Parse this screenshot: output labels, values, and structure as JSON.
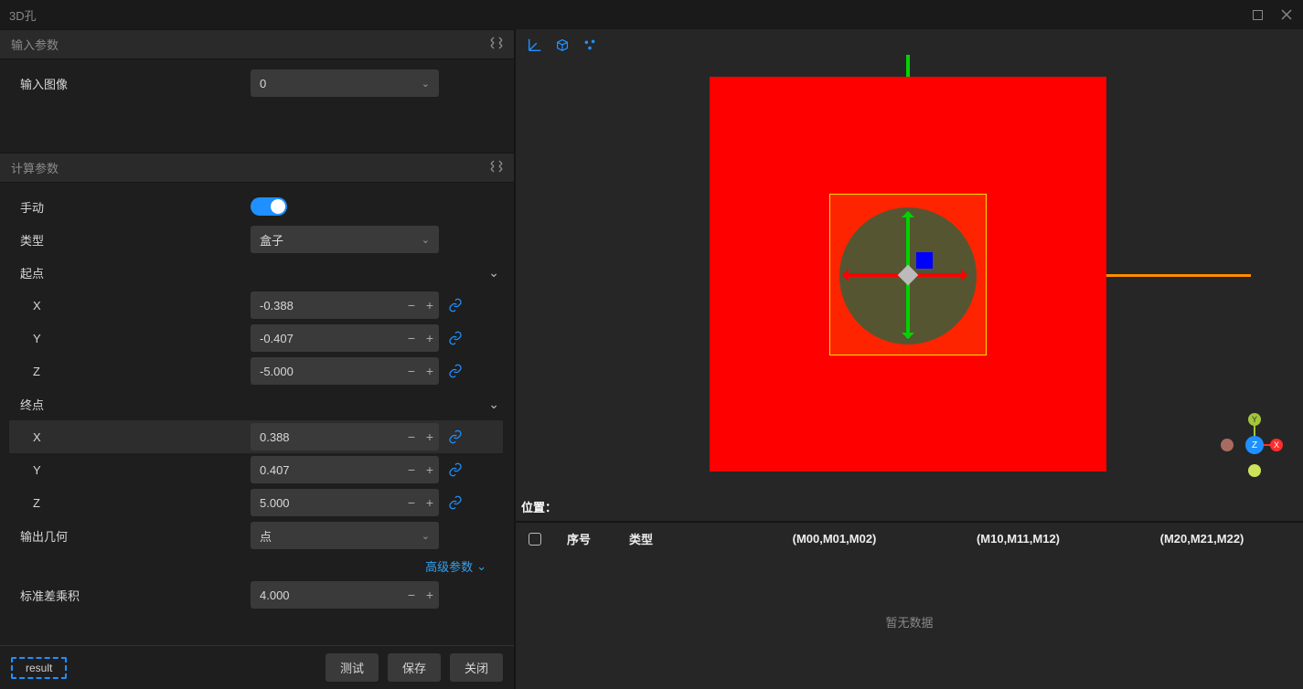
{
  "window": {
    "title": "3D孔"
  },
  "sections": {
    "input": "输入参数",
    "calc": "计算参数"
  },
  "input_params": {
    "image_label": "输入图像",
    "image_value": "0"
  },
  "calc_params": {
    "manual_label": "手动",
    "manual_on": true,
    "type_label": "类型",
    "type_value": "盒子",
    "start_label": "起点",
    "end_label": "终点",
    "start": {
      "x": "-0.388",
      "y": "-0.407",
      "z": "-5.000"
    },
    "end": {
      "x": "0.388",
      "y": "0.407",
      "z": "5.000"
    },
    "axes": {
      "x": "X",
      "y": "Y",
      "z": "Z"
    },
    "output_geom_label": "输出几何",
    "output_geom_value": "点",
    "adv_label": "高级参数",
    "std_dev_label": "标准差乘积",
    "std_dev_value": "4.000"
  },
  "footer": {
    "result": "result",
    "test": "测试",
    "save": "保存",
    "close": "关闭"
  },
  "viewport": {
    "position_label": "位置：",
    "gizmo": {
      "x": "X",
      "y": "Y",
      "z": "Z"
    }
  },
  "table": {
    "col_seq": "序号",
    "col_type": "类型",
    "col_m0": "(M00,M01,M02)",
    "col_m1": "(M10,M11,M12)",
    "col_m2": "(M20,M21,M22)",
    "empty": "暂无数据"
  }
}
